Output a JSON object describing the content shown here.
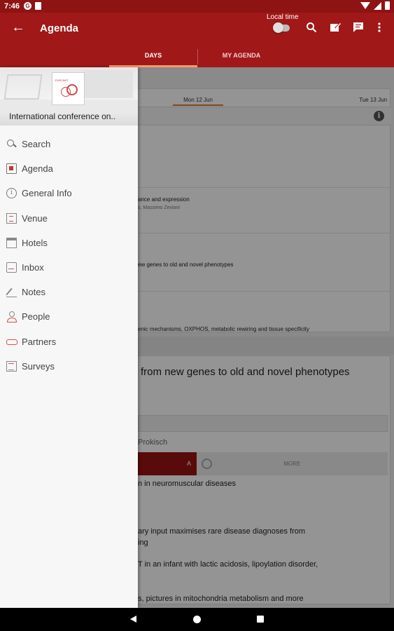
{
  "status_bar": {
    "time": "7:46",
    "icons": [
      "sync-icon",
      "sim-icon",
      "wifi-icon",
      "signal-icon",
      "battery-icon"
    ]
  },
  "app_bar": {
    "back_icon": "arrow-left-icon",
    "title": "Agenda",
    "local_time_label": "Local time",
    "local_time_enabled": false,
    "actions": [
      "search-icon",
      "edit-note-icon",
      "chat-icon",
      "more-vert-icon"
    ]
  },
  "tabs": [
    {
      "label": "DAYS",
      "selected": true
    },
    {
      "label": "MY AGENDA",
      "selected": false
    }
  ],
  "colors": {
    "app_bar": "#a01818",
    "status_bar": "#8e1313",
    "tab_indicator": "#ff9a6a",
    "drawer_bg": "#f7f7f7"
  },
  "drawer": {
    "conference_name": "International conference on..",
    "items": [
      {
        "label": "Search",
        "icon": "search-icon"
      },
      {
        "label": "Agenda",
        "icon": "agenda-icon"
      },
      {
        "label": "General Info",
        "icon": "info-icon"
      },
      {
        "label": "Venue",
        "icon": "venue-icon"
      },
      {
        "label": "Hotels",
        "icon": "hotels-icon"
      },
      {
        "label": "Inbox",
        "icon": "inbox-icon"
      },
      {
        "label": "Notes",
        "icon": "notes-icon"
      },
      {
        "label": "People",
        "icon": "people-icon"
      },
      {
        "label": "Partners",
        "icon": "partners-icon"
      },
      {
        "label": "Surveys",
        "icon": "surveys-icon"
      }
    ]
  },
  "background": {
    "days": {
      "current": "Mon 12 Jun",
      "next": "Tue 13 Jun"
    },
    "session_lines": [
      {
        "text": "ance and expression"
      },
      {
        "text": "s, Massimo Zeviani",
        "secondary": true
      },
      {
        "text": "ew genes to old and novel phenotypes"
      },
      {
        "text": "enic mechanisms, OXPHOS, metabolic rewiring and tissue specificity"
      }
    ],
    "detail": {
      "title": "from new genes to old and novel phenotypes",
      "person": "Prokisch",
      "primary_button": "A",
      "secondary_button": "MORE",
      "lines": [
        "n in neuromuscular diseases",
        "ary input maximises rare disease diagnoses from",
        "ing",
        "T in an infant with lactic acidosis, lipoylation disorder,",
        "s, pictures in mitochondria metabolism and more"
      ]
    }
  }
}
